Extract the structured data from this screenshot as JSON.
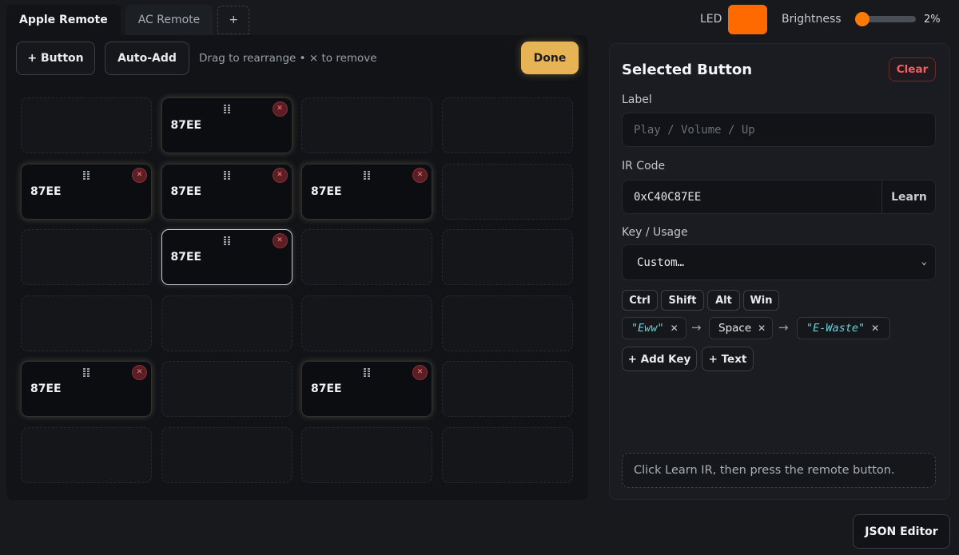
{
  "tabs": [
    {
      "label": "Apple Remote",
      "active": true
    },
    {
      "label": "AC Remote",
      "active": false
    },
    {
      "label": "+",
      "active": false
    }
  ],
  "header": {
    "led_label": "LED",
    "led_color": "#ff6a00",
    "brightness_label": "Brightness",
    "brightness_value": "2%",
    "brightness_fraction": 0.02
  },
  "toolbar": {
    "add_button_label": "+ Button",
    "auto_add_label": "Auto-Add",
    "hint": "Drag to rearrange • × to remove",
    "done_label": "Done"
  },
  "grid": {
    "rows": 6,
    "cols": 4,
    "buttons": [
      {
        "row": 0,
        "col": 1,
        "label": "87EE",
        "selected": false
      },
      {
        "row": 1,
        "col": 0,
        "label": "87EE",
        "selected": false
      },
      {
        "row": 1,
        "col": 1,
        "label": "87EE",
        "selected": false
      },
      {
        "row": 1,
        "col": 2,
        "label": "87EE",
        "selected": false
      },
      {
        "row": 2,
        "col": 1,
        "label": "87EE",
        "selected": true
      },
      {
        "row": 4,
        "col": 0,
        "label": "87EE",
        "selected": false
      },
      {
        "row": 4,
        "col": 2,
        "label": "87EE",
        "selected": false
      }
    ]
  },
  "selected_panel": {
    "title": "Selected Button",
    "clear_label": "Clear",
    "label_field_label": "Label",
    "label_placeholder": "Play / Volume / Up",
    "label_value": "",
    "ir_code_label": "IR Code",
    "ir_code_value": "0xC40C87EE",
    "learn_label": "Learn",
    "key_usage_label": "Key / Usage",
    "key_usage_value": "Custom…",
    "modifiers": [
      "Ctrl",
      "Shift",
      "Alt",
      "Win"
    ],
    "sequence": [
      {
        "type": "text",
        "label": "\"Eww\""
      },
      {
        "type": "key",
        "label": "Space"
      },
      {
        "type": "text",
        "label": "\"E-Waste\""
      }
    ],
    "add_key_label": "+ Add Key",
    "add_text_label": "+ Text",
    "status_text": "Click Learn IR, then press the remote button."
  },
  "footer": {
    "json_editor_label": "JSON Editor"
  }
}
